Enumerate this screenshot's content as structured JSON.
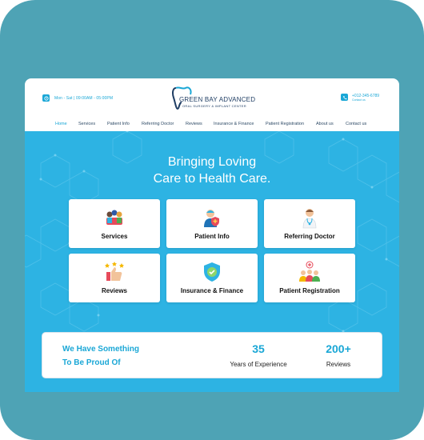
{
  "header": {
    "hours": "Mon - Sat | 09:00AM - 05:00PM",
    "logo": {
      "name": "GREEN BAY ADVANCED",
      "subtitle": "ORAL SURGERY & IMPLANT CENTER"
    },
    "phone": {
      "number": "+012-345-6789",
      "label": "Contact us"
    }
  },
  "nav": {
    "items": [
      "Home",
      "Services",
      "Patient Info",
      "Referring Doctor",
      "Reviews",
      "Insurance & Finance",
      "Patient Registration",
      "About us",
      "Contact us"
    ],
    "active": "Home"
  },
  "hero": {
    "title_line1": "Bringing Loving",
    "title_line2": "Care to Health Care."
  },
  "cards": [
    {
      "label": "Services",
      "icon": "team-icon"
    },
    {
      "label": "Patient Info",
      "icon": "patient-icon"
    },
    {
      "label": "Referring Doctor",
      "icon": "doctor-icon"
    },
    {
      "label": "Reviews",
      "icon": "thumbs-up-stars-icon"
    },
    {
      "label": "Insurance & Finance",
      "icon": "shield-check-icon"
    },
    {
      "label": "Patient Registration",
      "icon": "registration-group-icon"
    }
  ],
  "stats": {
    "heading_line1": "We Have Something",
    "heading_line2": "To Be Proud Of",
    "items": [
      {
        "value": "35",
        "label": "Years of Experience"
      },
      {
        "value": "200+",
        "label": "Reviews"
      }
    ]
  },
  "colors": {
    "frame": "#4ea3b5",
    "accent": "#1aa7d6",
    "hero_bg": "#2db3e3",
    "navy": "#1f3d63"
  }
}
